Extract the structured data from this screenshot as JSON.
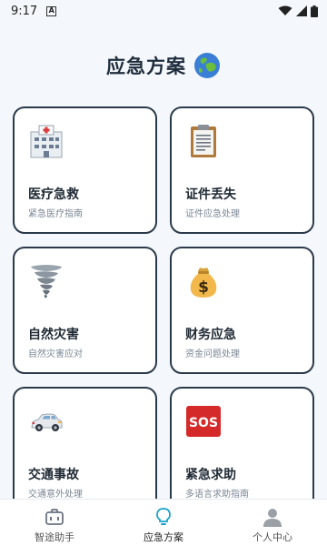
{
  "status_bar": {
    "time": "9:17",
    "notification_letter": "A"
  },
  "header": {
    "title": "应急方案",
    "icon": "globe-icon"
  },
  "cards": [
    {
      "title": "医疗急救",
      "subtitle": "紧急医疗指南",
      "icon": "hospital-icon"
    },
    {
      "title": "证件丢失",
      "subtitle": "证件应急处理",
      "icon": "clipboard-icon"
    },
    {
      "title": "自然灾害",
      "subtitle": "自然灾害应对",
      "icon": "tornado-icon"
    },
    {
      "title": "财务应急",
      "subtitle": "资金问题处理",
      "icon": "money-bag-icon"
    },
    {
      "title": "交通事故",
      "subtitle": "交通意外处理",
      "icon": "car-icon"
    },
    {
      "title": "紧急求助",
      "subtitle": "多语言求助指南",
      "icon": "sos-icon",
      "sos_text": "SOS"
    }
  ],
  "bottom_nav": [
    {
      "label": "智途助手",
      "icon": "briefcase-icon",
      "active": false
    },
    {
      "label": "应急方案",
      "icon": "lightbulb-icon",
      "active": true
    },
    {
      "label": "个人中心",
      "icon": "person-icon",
      "active": false
    }
  ],
  "colors": {
    "accent": "#1aa3c7",
    "card_border": "#2b3a4a",
    "background": "#f4f7fb"
  }
}
